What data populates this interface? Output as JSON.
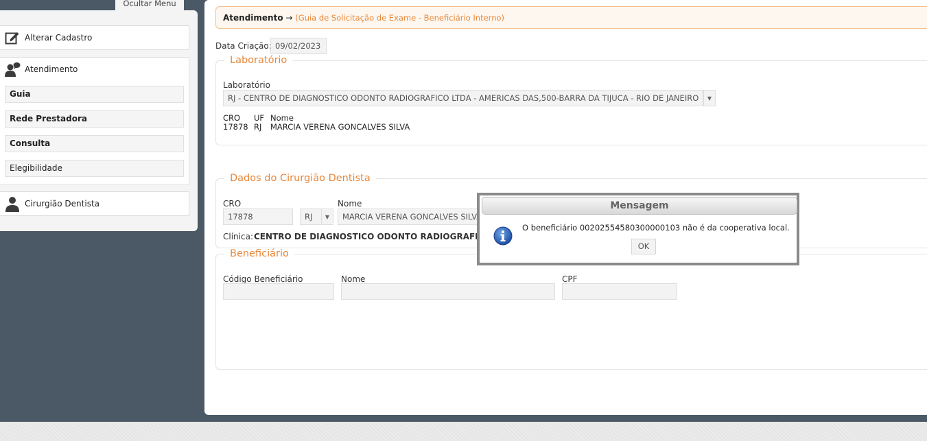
{
  "sidebar": {
    "toggle_label": "Ocultar Menu",
    "alterar_cadastro": "Alterar Cadastro",
    "atendimento": "Atendimento",
    "atendimento_items": [
      {
        "label": "Guia"
      },
      {
        "label": "Rede Prestadora"
      },
      {
        "label": "Consulta"
      },
      {
        "label": "Elegibilidade"
      }
    ],
    "cirurgiao": "Cirurgião Dentista"
  },
  "breadcrumb": {
    "root": "Atendimento",
    "arrow": "→",
    "current": "(Guia de Solicitação de Exame - Beneficiário Interno)"
  },
  "data_criacao": {
    "label": "Data Criação:",
    "value": "09/02/2023"
  },
  "laboratorio": {
    "legend": "Laboratório",
    "field_label": "Laboratório",
    "selected": "RJ - CENTRO DE DIAGNOSTICO ODONTO RADIOGRAFICO LTDA - AMERICAS DAS,500-BARRA DA TIJUCA - RIO DE JANEIRO",
    "cro_header": "CRO",
    "uf_header": "UF",
    "nome_header": "Nome",
    "cro_value": "17878",
    "uf_value": "RJ",
    "nome_value": "MARCIA VERENA GONCALVES SILVA"
  },
  "dentista": {
    "legend": "Dados do Cirurgião Dentista",
    "cro_label": "CRO",
    "cro_value": "17878",
    "uf_value": "RJ",
    "nome_label": "Nome",
    "nome_value": "MARCIA VERENA GONCALVES SILVA",
    "clinica_label": "Clínica:",
    "clinica_value": "CENTRO DE DIAGNOSTICO ODONTO RADIOGRAFICO"
  },
  "beneficiario": {
    "legend": "Beneficiário",
    "codigo_label": "Código Beneficiário",
    "nome_label": "Nome",
    "cpf_label": "CPF",
    "codigo_value": "",
    "nome_value": "",
    "cpf_value": ""
  },
  "dialog": {
    "title": "Mensagem",
    "message": "O beneficiário 00202554580300000103 não é da cooperativa local.",
    "ok_label": "OK"
  },
  "colors": {
    "accent": "#e8873a",
    "sidebar_bg": "#4b5966"
  }
}
